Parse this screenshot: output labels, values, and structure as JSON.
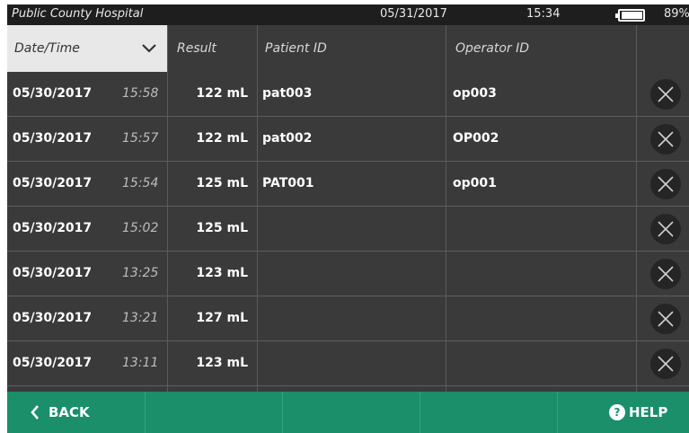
{
  "status": {
    "hospital": "Public County Hospital",
    "date": "05/31/2017",
    "time": "15:34",
    "battery_percent": "89%",
    "battery_level": 0.89
  },
  "header": {
    "sort_column": "Date/Time",
    "result": "Result",
    "patient_id": "Patient ID",
    "operator_id": "Operator ID"
  },
  "rows": [
    {
      "date": "05/30/2017",
      "time": "15:58",
      "result": "122 mL",
      "patient": "pat003",
      "operator": "op003"
    },
    {
      "date": "05/30/2017",
      "time": "15:57",
      "result": "122 mL",
      "patient": "pat002",
      "operator": "OP002"
    },
    {
      "date": "05/30/2017",
      "time": "15:54",
      "result": "125 mL",
      "patient": "PAT001",
      "operator": "op001"
    },
    {
      "date": "05/30/2017",
      "time": "15:02",
      "result": "125 mL",
      "patient": "",
      "operator": ""
    },
    {
      "date": "05/30/2017",
      "time": "13:25",
      "result": "123 mL",
      "patient": "",
      "operator": ""
    },
    {
      "date": "05/30/2017",
      "time": "13:21",
      "result": "127 mL",
      "patient": "",
      "operator": ""
    },
    {
      "date": "05/30/2017",
      "time": "13:11",
      "result": "123 mL",
      "patient": "",
      "operator": ""
    }
  ],
  "footer": {
    "back_label": "BACK",
    "help_label": "HELP"
  },
  "icons": {
    "sort": "chevron-down-icon",
    "delete": "close-icon",
    "back": "chevron-left-icon",
    "help": "question-circle-icon"
  },
  "colors": {
    "footer_accent": "#1a8f6a",
    "row_background": "#3a3a3a"
  }
}
